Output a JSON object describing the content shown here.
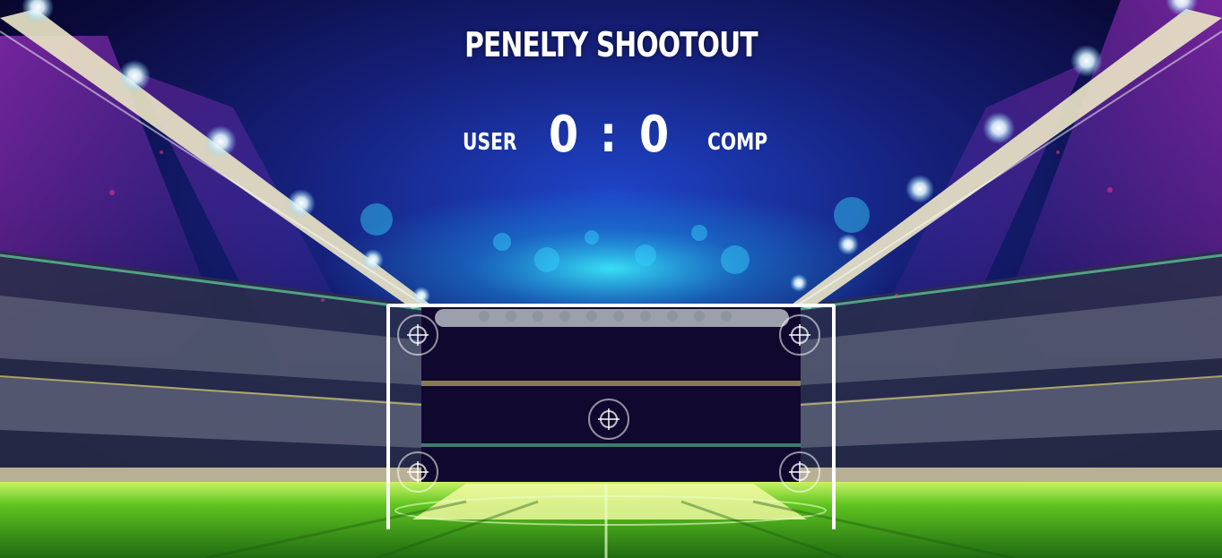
{
  "game": {
    "title": "PENELTY SHOOTOUT",
    "user_label": "USER",
    "comp_label": "COMP",
    "user_score": "0",
    "separator": ":",
    "comp_score": "0"
  },
  "targets": [
    {
      "name": "target-top-left-icon"
    },
    {
      "name": "target-top-right-icon"
    },
    {
      "name": "target-center-icon"
    },
    {
      "name": "target-bottom-left-icon"
    },
    {
      "name": "target-bottom-right-icon"
    }
  ],
  "colors": {
    "sky_dark": "#05031a",
    "sky_blue": "#1b2a9a",
    "purple_light": "#b03adf",
    "cyan_glow": "#20e0ff",
    "pitch_green": "#3db21a"
  }
}
